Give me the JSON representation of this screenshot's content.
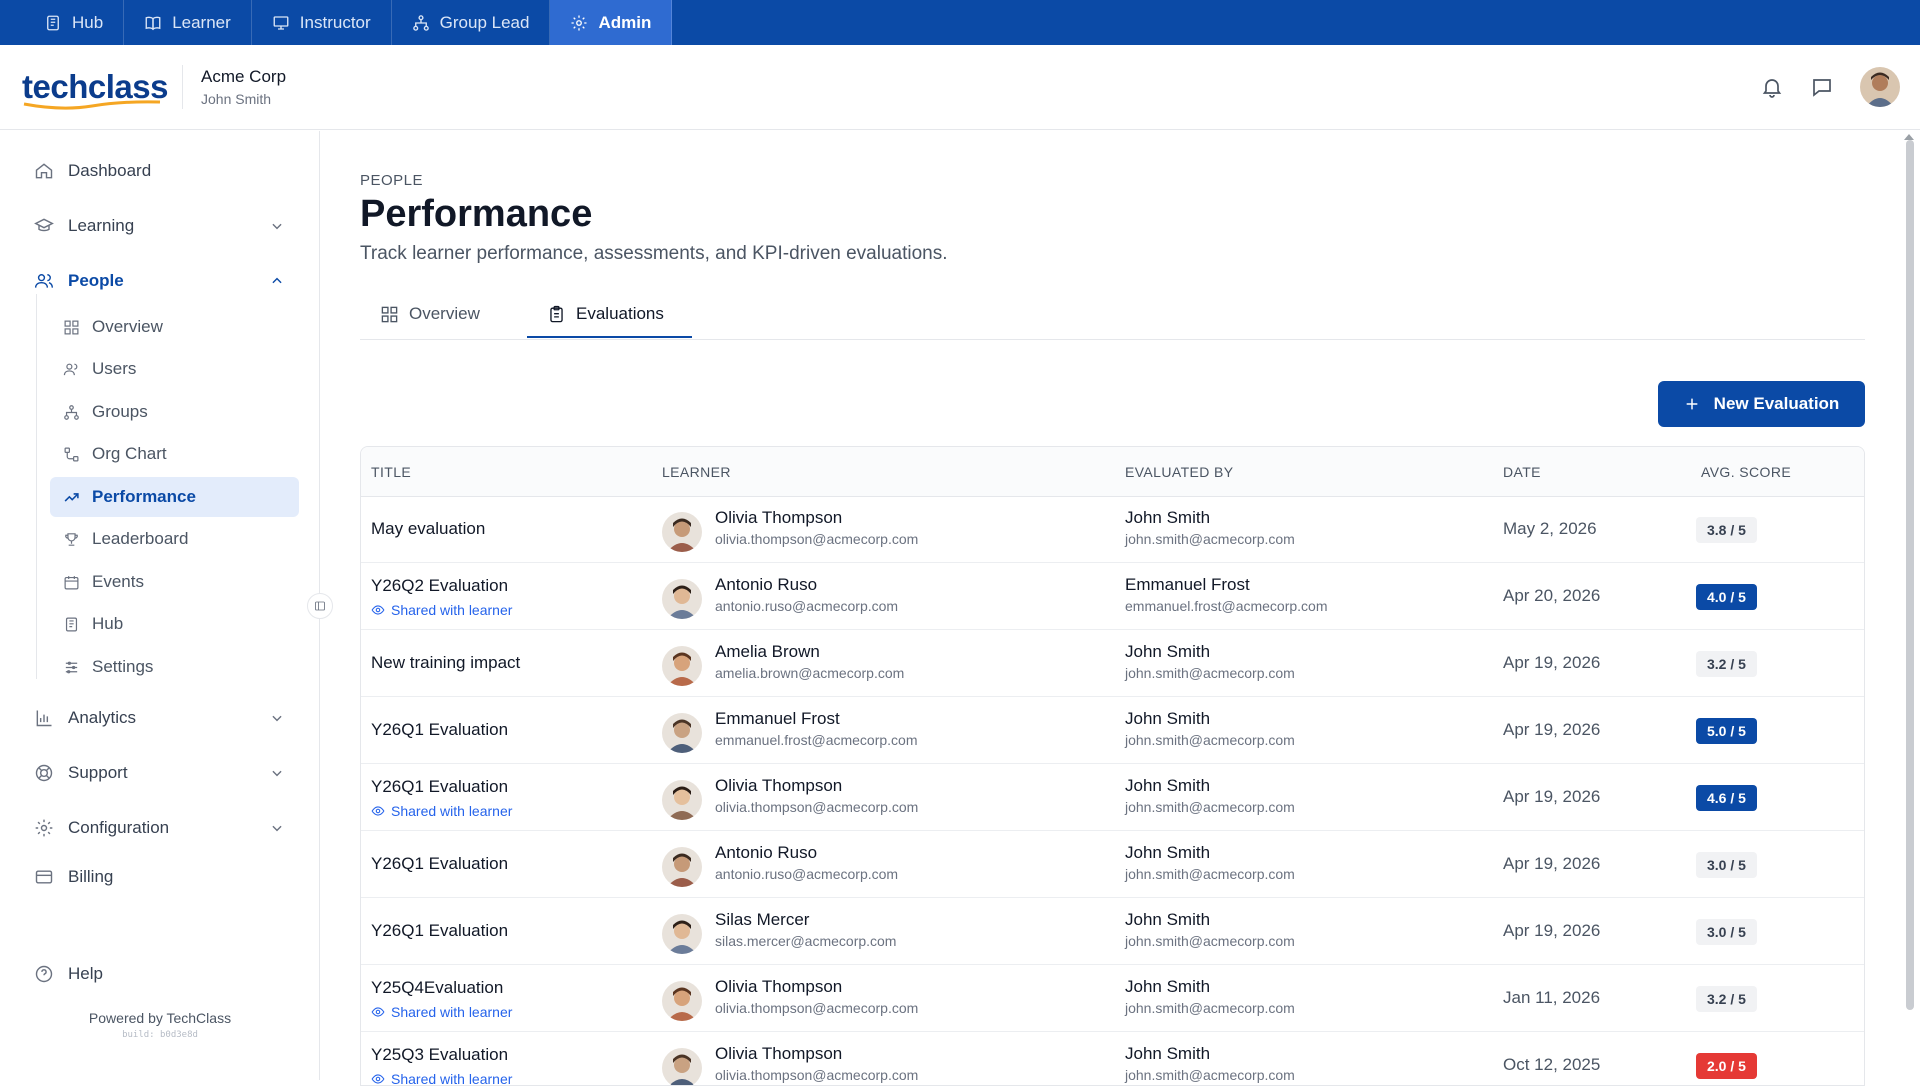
{
  "rolebar": {
    "items": [
      {
        "label": "Hub",
        "icon": "book-stack-icon"
      },
      {
        "label": "Learner",
        "icon": "open-book-icon"
      },
      {
        "label": "Instructor",
        "icon": "presentation-icon"
      },
      {
        "label": "Group Lead",
        "icon": "hierarchy-icon"
      },
      {
        "label": "Admin",
        "icon": "gear-icon",
        "active": true
      }
    ]
  },
  "header": {
    "logo": "techclass",
    "org_name": "Acme Corp",
    "user_name": "John Smith"
  },
  "sidebar": {
    "dashboard": "Dashboard",
    "learning": "Learning",
    "people": "People",
    "people_sub": [
      "Overview",
      "Users",
      "Groups",
      "Org Chart",
      "Performance",
      "Leaderboard",
      "Events",
      "Hub",
      "Settings"
    ],
    "analytics": "Analytics",
    "support": "Support",
    "configuration": "Configuration",
    "billing": "Billing",
    "help": "Help",
    "powered": "Powered by TechClass",
    "build": "build: b0d3e8d"
  },
  "page": {
    "eyebrow": "PEOPLE",
    "title": "Performance",
    "subtitle": "Track learner performance, assessments, and KPI-driven evaluations.",
    "tabs": [
      "Overview",
      "Evaluations"
    ],
    "active_tab": "Evaluations",
    "new_button": "New Evaluation"
  },
  "table": {
    "headers": [
      "TITLE",
      "LEARNER",
      "EVALUATED BY",
      "DATE",
      "AVG. SCORE"
    ],
    "shared_label": "Shared with learner",
    "rows": [
      {
        "title": "May evaluation",
        "shared": false,
        "learner": "Olivia Thompson",
        "learner_email": "olivia.thompson@acmecorp.com",
        "evaluator": "John Smith",
        "evaluator_email": "john.smith@acmecorp.com",
        "date": "May 2, 2026",
        "score": "3.8 / 5",
        "score_style": "grey"
      },
      {
        "title": "Y26Q2 Evaluation",
        "shared": true,
        "learner": "Antonio Ruso",
        "learner_email": "antonio.ruso@acmecorp.com",
        "evaluator": "Emmanuel Frost",
        "evaluator_email": "emmanuel.frost@acmecorp.com",
        "date": "Apr 20, 2026",
        "score": "4.0 / 5",
        "score_style": "blue"
      },
      {
        "title": "New training impact",
        "shared": false,
        "learner": "Amelia Brown",
        "learner_email": "amelia.brown@acmecorp.com",
        "evaluator": "John Smith",
        "evaluator_email": "john.smith@acmecorp.com",
        "date": "Apr 19, 2026",
        "score": "3.2 / 5",
        "score_style": "grey"
      },
      {
        "title": "Y26Q1 Evaluation",
        "shared": false,
        "learner": "Emmanuel Frost",
        "learner_email": "emmanuel.frost@acmecorp.com",
        "evaluator": "John Smith",
        "evaluator_email": "john.smith@acmecorp.com",
        "date": "Apr 19, 2026",
        "score": "5.0 / 5",
        "score_style": "blue"
      },
      {
        "title": "Y26Q1 Evaluation",
        "shared": true,
        "learner": "Olivia Thompson",
        "learner_email": "olivia.thompson@acmecorp.com",
        "evaluator": "John Smith",
        "evaluator_email": "john.smith@acmecorp.com",
        "date": "Apr 19, 2026",
        "score": "4.6 / 5",
        "score_style": "blue"
      },
      {
        "title": "Y26Q1 Evaluation",
        "shared": false,
        "learner": "Antonio Ruso",
        "learner_email": "antonio.ruso@acmecorp.com",
        "evaluator": "John Smith",
        "evaluator_email": "john.smith@acmecorp.com",
        "date": "Apr 19, 2026",
        "score": "3.0 / 5",
        "score_style": "grey"
      },
      {
        "title": "Y26Q1 Evaluation",
        "shared": false,
        "learner": "Silas Mercer",
        "learner_email": "silas.mercer@acmecorp.com",
        "evaluator": "John Smith",
        "evaluator_email": "john.smith@acmecorp.com",
        "date": "Apr 19, 2026",
        "score": "3.0 / 5",
        "score_style": "grey"
      },
      {
        "title": "Y25Q4Evaluation",
        "shared": true,
        "learner": "Olivia Thompson",
        "learner_email": "olivia.thompson@acmecorp.com",
        "evaluator": "John Smith",
        "evaluator_email": "john.smith@acmecorp.com",
        "date": "Jan 11, 2026",
        "score": "3.2 / 5",
        "score_style": "grey"
      },
      {
        "title": "Y25Q3 Evaluation",
        "shared": true,
        "learner": "Olivia Thompson",
        "learner_email": "olivia.thompson@acmecorp.com",
        "evaluator": "John Smith",
        "evaluator_email": "john.smith@acmecorp.com",
        "date": "Oct 12, 2025",
        "score": "2.0 / 5",
        "score_style": "red"
      }
    ]
  },
  "colors": {
    "brand": "#0b4aa6",
    "accent_light": "#e3ecfb",
    "danger": "#e53935"
  }
}
